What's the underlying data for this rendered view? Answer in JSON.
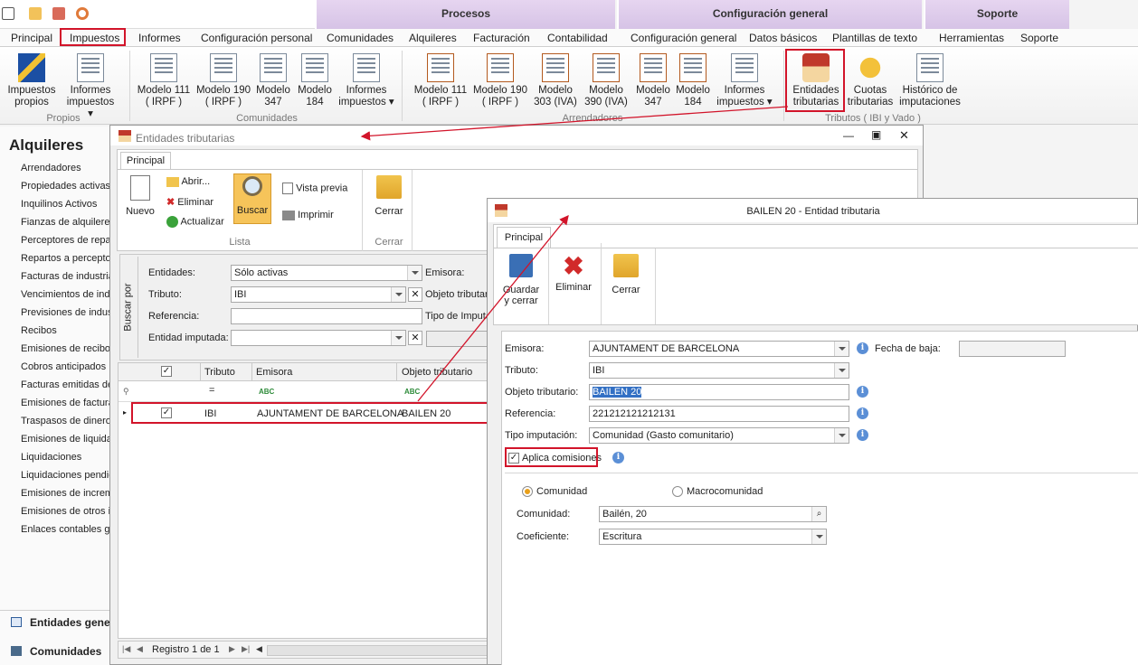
{
  "ribbon": {
    "groups": [
      {
        "label": "Procesos"
      },
      {
        "label": "Configuración general"
      },
      {
        "label": "Soporte"
      }
    ],
    "tabs": [
      "Principal",
      "Impuestos",
      "Informes",
      "Configuración personal",
      "Comunidades",
      "Alquileres",
      "Facturación",
      "Contabilidad",
      "Configuración general",
      "Datos básicos",
      "Plantillas de texto",
      "Herramientas",
      "Soporte"
    ],
    "buttons": {
      "impuestos_propios": "Impuestos propios",
      "informes_impuestos_1": "Informes impuestos",
      "modelo111_a": "Modelo 111 ( IRPF )",
      "modelo190_a": "Modelo 190 ( IRPF )",
      "modelo347_a": "Modelo 347",
      "modelo184_a": "Modelo 184",
      "informes_impuestos_2": "Informes impuestos",
      "modelo111_b": "Modelo 111 ( IRPF )",
      "modelo190_b": "Modelo 190 ( IRPF )",
      "modelo303": "Modelo 303 (IVA)",
      "modelo390": "Modelo 390 (IVA)",
      "modelo347_b": "Modelo 347",
      "modelo184_b": "Modelo 184",
      "informes_impuestos_3": "Informes impuestos",
      "entidades_tributarias": "Entidades tributarias",
      "cuotas_tributarias": "Cuotas tributarias",
      "historico_imputaciones": "Histórico de imputaciones"
    },
    "group_labels": {
      "propios": "Propios",
      "comunidades": "Comunidades",
      "arrendadores": "Arrendadores",
      "tributos": "Tributos ( IBI y Vado )"
    }
  },
  "sidebar": {
    "title": "Alquileres",
    "items": [
      "Arrendadores",
      "Propiedades activas",
      "Inquilinos Activos",
      "Fianzas de alquileres",
      "Perceptores de repa",
      "Repartos a percepto",
      "Facturas de industria",
      "Vencimientos de indu",
      "Previsiones de indust",
      "Recibos",
      "Emisiones de recibos",
      "Cobros anticipados",
      "Facturas emitidas de",
      "Emisiones de factura",
      "Traspasos de dinero",
      "Emisiones de liquidac",
      "Liquidaciones",
      "Liquidaciones pendie",
      "Emisiones de increme",
      "Emisiones de otros in",
      "Enlaces contables ge"
    ],
    "bottom": [
      "Entidades gener",
      "Comunidades"
    ]
  },
  "win1": {
    "title": "Entidades tributarias",
    "tab": "Principal",
    "buttons": {
      "nuevo": "Nuevo",
      "abrir": "Abrir...",
      "eliminar": "Eliminar",
      "actualizar": "Actualizar",
      "buscar": "Buscar",
      "vista_previa": "Vista previa",
      "imprimir": "Imprimir",
      "cerrar": "Cerrar"
    },
    "groups": {
      "lista": "Lista",
      "cerrar": "Cerrar"
    },
    "buscar_por": "Buscar por",
    "filters": {
      "entidades_label": "Entidades:",
      "entidades_value": "Sólo activas",
      "tributo_label": "Tributo:",
      "tributo_value": "IBI",
      "referencia_label": "Referencia:",
      "entidad_imputada_label": "Entidad imputada:",
      "emisora_label": "Emisora:",
      "objeto_label": "Objeto tributar",
      "tipo_label": "Tipo de Imputa"
    },
    "grid": {
      "columns": [
        "Tributo",
        "Emisora",
        "Objeto tributario"
      ],
      "filter_eq": "=",
      "row": {
        "tributo": "IBI",
        "emisora": "AJUNTAMENT DE BARCELONA",
        "objeto": "BAILEN 20"
      }
    },
    "status": "Registro 1 de 1"
  },
  "win2": {
    "title": "BAILEN 20 - Entidad tributaria",
    "tab": "Principal",
    "buttons": {
      "guardar": "Guardar y cerrar",
      "eliminar": "Eliminar",
      "cerrar": "Cerrar"
    },
    "form": {
      "emisora_label": "Emisora:",
      "emisora_value": "AJUNTAMENT DE BARCELONA",
      "fecha_baja_label": "Fecha de baja:",
      "tributo_label": "Tributo:",
      "tributo_value": "IBI",
      "objeto_label": "Objeto tributario:",
      "objeto_value": "BAILEN 20",
      "referencia_label": "Referencia:",
      "referencia_value": "221212121212131",
      "tipo_label": "Tipo imputación:",
      "tipo_value": "Comunidad (Gasto comunitario)",
      "aplica_label": "Aplica comisiones",
      "radio_comunidad": "Comunidad",
      "radio_macro": "Macrocomunidad",
      "comunidad_label": "Comunidad:",
      "comunidad_value": "Bailén, 20",
      "coeficiente_label": "Coeficiente:",
      "coeficiente_value": "Escritura"
    }
  },
  "colors": {
    "highlight": "#d2142a",
    "ribbon_group": "#d6c3e6",
    "selected_button": "#f6c45a"
  }
}
